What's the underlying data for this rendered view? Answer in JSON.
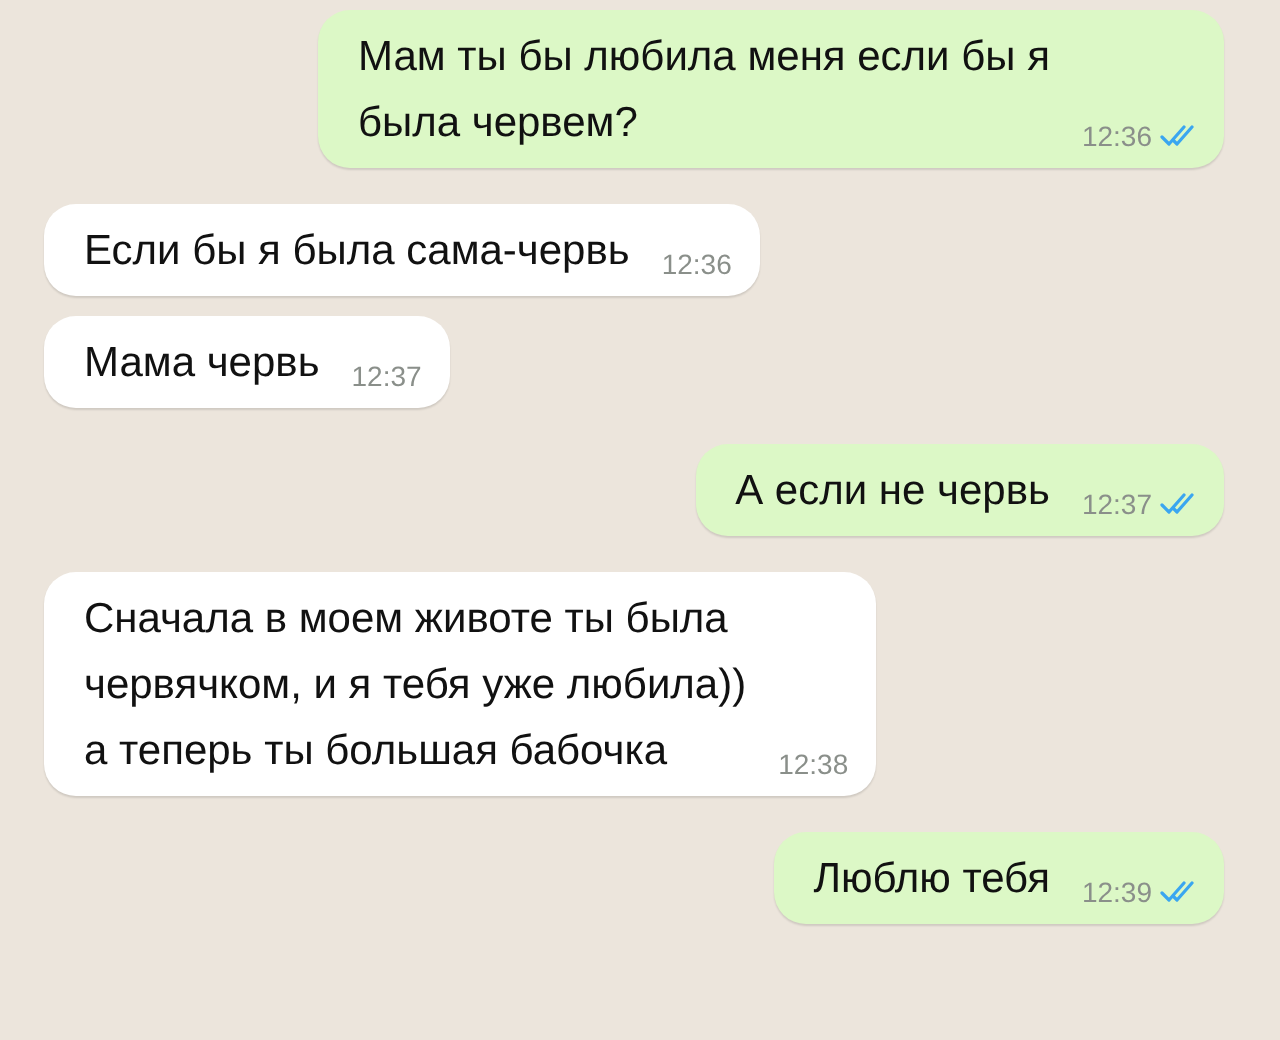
{
  "messages": [
    {
      "kind": "outgoing",
      "text": "Мам ты бы любила меня если бы я\nбыла червем?",
      "time": "12:36",
      "read": true
    },
    {
      "kind": "incoming",
      "text": "Если бы я была сама-червь",
      "time": "12:36"
    },
    {
      "kind": "incoming",
      "text": "Мама червь",
      "time": "12:37"
    },
    {
      "kind": "outgoing",
      "text": "А если не червь",
      "time": "12:37",
      "read": true
    },
    {
      "kind": "incoming",
      "text": "Сначала в моем животе ты была\nчервячком, и я тебя уже любила))\nа теперь ты большая бабочка",
      "time": "12:38"
    },
    {
      "kind": "outgoing",
      "text": "Люблю тебя",
      "time": "12:39",
      "read": true
    }
  ]
}
